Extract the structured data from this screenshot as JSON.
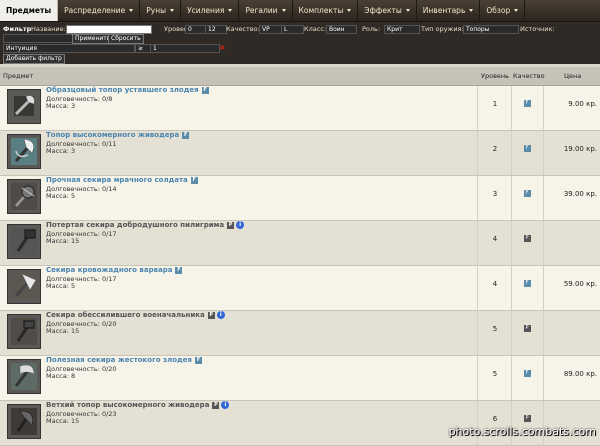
{
  "nav": {
    "items": [
      {
        "label": "Предметы",
        "active": true
      },
      {
        "label": "Распределение"
      },
      {
        "label": "Руны"
      },
      {
        "label": "Усиления"
      },
      {
        "label": "Регалии"
      },
      {
        "label": "Комплекты"
      },
      {
        "label": "Эффекты"
      },
      {
        "label": "Инвентарь"
      },
      {
        "label": "Обзор"
      }
    ]
  },
  "filters": {
    "title": "Фильтр",
    "name_label": "Название:",
    "name_value": "",
    "level_label": "Уровень:",
    "level_from": "0",
    "level_to": "12",
    "quality_label": "Качество:",
    "quality_value": "VP",
    "quality_value2": "L",
    "class_label": "Класс:",
    "class_value": "Воин",
    "role_label": "Роль:",
    "role_value": "Крит",
    "weapon_label": "Тип оружия:",
    "weapon_value": "Топоры",
    "source_label": "Источник:",
    "apply": "Применить",
    "reset": "Сбросить",
    "stat_value": "Интуиция",
    "op_value": "≥",
    "stat_amount": "1",
    "add_filter": "Добавить фильтр"
  },
  "table": {
    "headers": {
      "item": "Предмет",
      "level": "Уровень",
      "quality": "Качество",
      "price": "Цена"
    },
    "rows": [
      {
        "name": "Образцовый топор уставшего злодея",
        "badge": "F",
        "durability": "Долговечность: 0/8",
        "mass": "Масса: 3",
        "level": "1",
        "quality": "F",
        "price": "9.00 кр.",
        "link": true,
        "info": false
      },
      {
        "name": "Топор высокомерного живодера",
        "badge": "F",
        "durability": "Долговечность: 0/11",
        "mass": "Масса: 3",
        "level": "2",
        "quality": "F",
        "price": "19.00 кр.",
        "link": true,
        "info": false
      },
      {
        "name": "Прочная секира мрачного солдата",
        "badge": "F",
        "durability": "Долговечность: 0/14",
        "mass": "Масса: 5",
        "level": "3",
        "quality": "F",
        "price": "39.00 кр.",
        "link": true,
        "info": false
      },
      {
        "name": "Потертая секира добродушного пилигрима",
        "badge": "P",
        "durability": "Долговечность: 0/17",
        "mass": "Масса: 15",
        "level": "4",
        "quality": "P",
        "price": "",
        "link": false,
        "info": true
      },
      {
        "name": "Секира кровожадного варвара",
        "badge": "F",
        "durability": "Долговечность: 0/17",
        "mass": "Масса: 5",
        "level": "4",
        "quality": "F",
        "price": "59.00 кр.",
        "link": true,
        "info": false
      },
      {
        "name": "Секира обессилившего военачальника",
        "badge": "P",
        "durability": "Долговечность: 0/20",
        "mass": "Масса: 15",
        "level": "5",
        "quality": "P",
        "price": "",
        "link": false,
        "info": true
      },
      {
        "name": "Полезная секира жестокого злодея",
        "badge": "F",
        "durability": "Долговечность: 0/20",
        "mass": "Масса: 8",
        "level": "5",
        "quality": "F",
        "price": "89.00 кр.",
        "link": true,
        "info": false
      },
      {
        "name": "Ветхий топор высокомерного живодера",
        "badge": "P",
        "durability": "Долговечность: 0/23",
        "mass": "Масса: 15",
        "level": "6",
        "quality": "P",
        "price": "",
        "link": false,
        "info": true
      }
    ]
  },
  "watermark": "photo.scrolls.combats.com"
}
